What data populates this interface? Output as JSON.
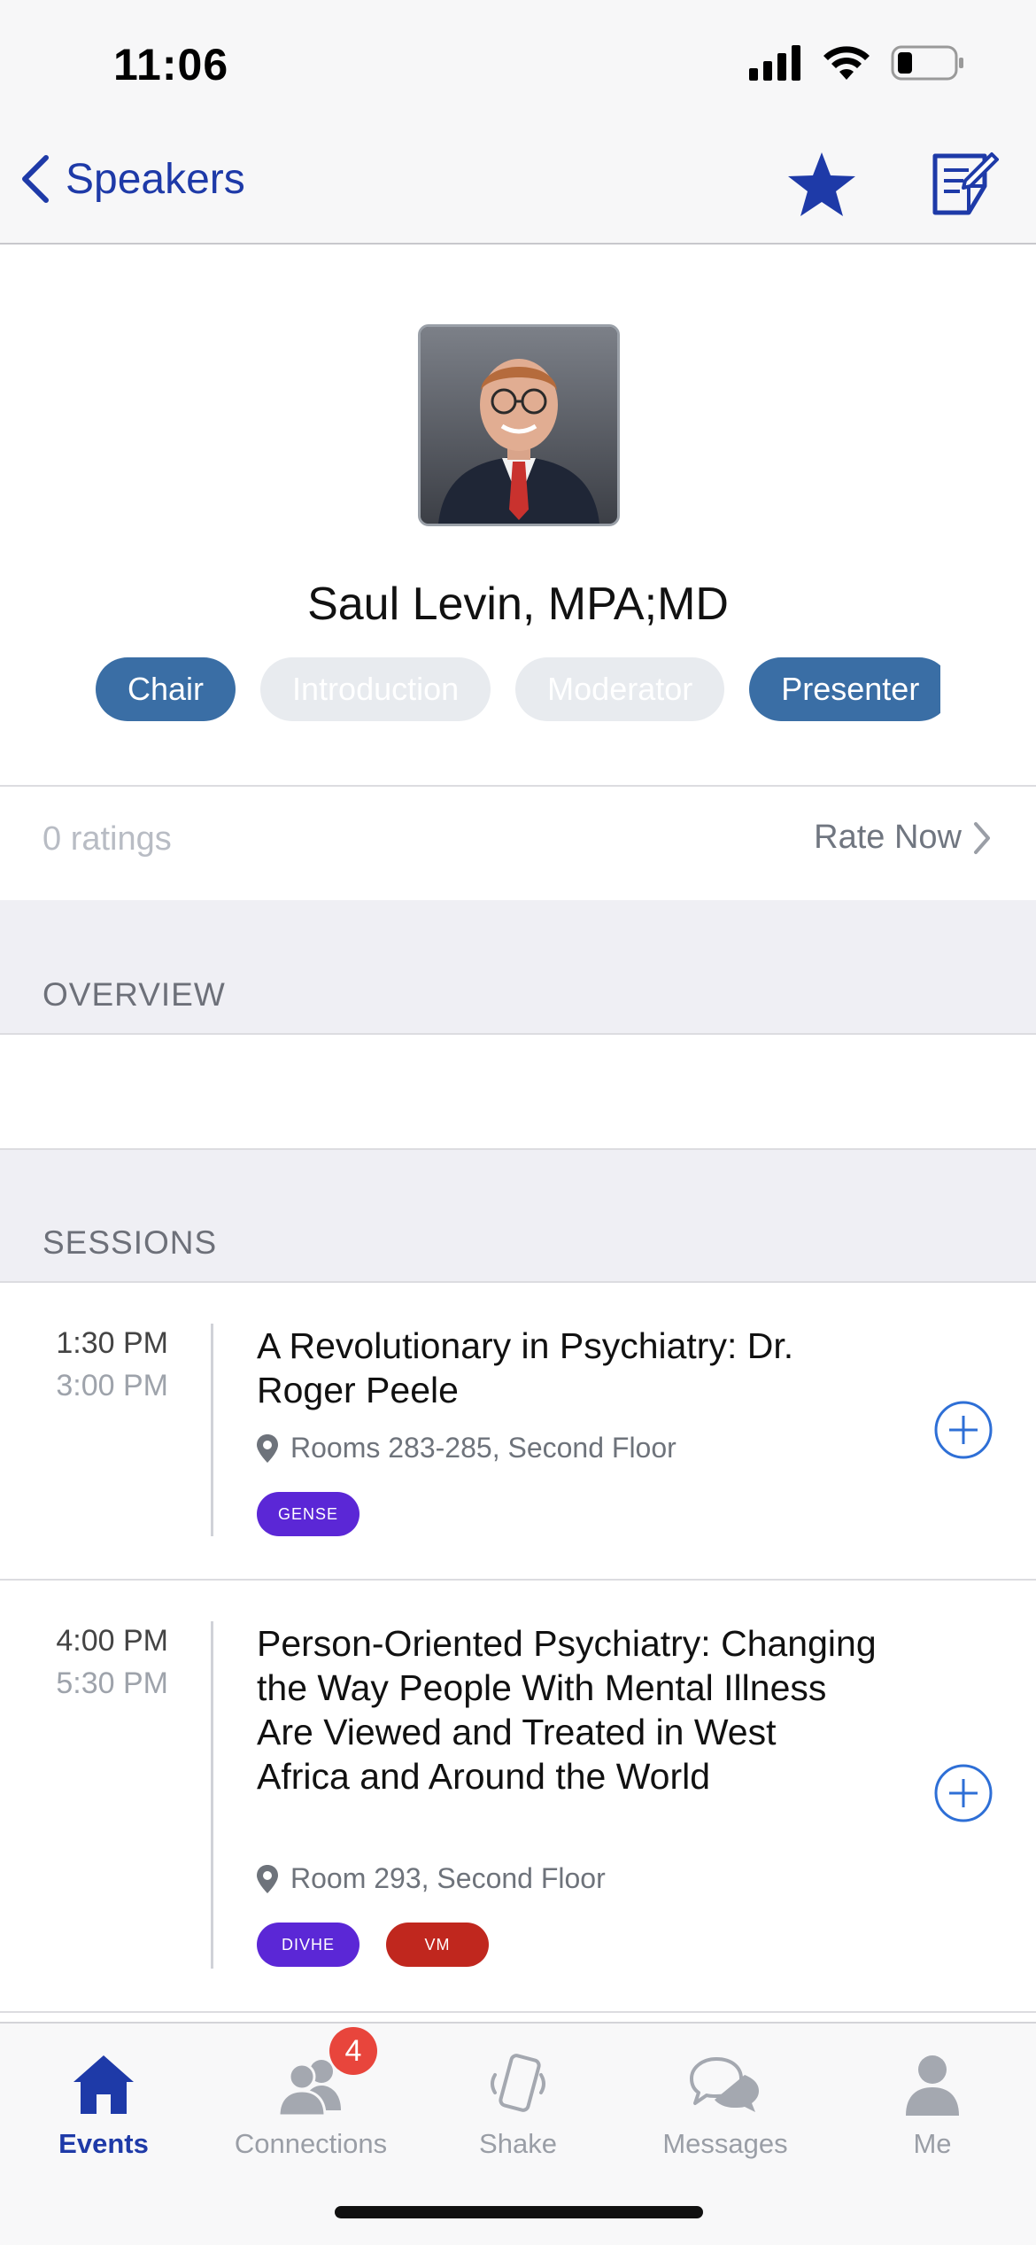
{
  "status_bar": {
    "time": "11:06"
  },
  "nav": {
    "back_label": "Speakers",
    "accent": "#1e3aa8"
  },
  "speaker": {
    "name": "Saul Levin, MPA;MD",
    "roles": [
      {
        "label": "Chair",
        "active": true
      },
      {
        "label": "Introduction",
        "active": false
      },
      {
        "label": "Moderator",
        "active": false
      },
      {
        "label": "Presenter",
        "active": true
      }
    ]
  },
  "ratings": {
    "count_text": "0 ratings",
    "rate_now_label": "Rate Now"
  },
  "overview": {
    "header": "OVERVIEW"
  },
  "sessions": {
    "header": "SESSIONS",
    "items": [
      {
        "start": "1:30 PM",
        "end": "3:00 PM",
        "title": "A Revolutionary in Psychiatry: Dr. Roger Peele",
        "location": "Rooms 283-285, Second Floor",
        "tags": [
          {
            "label": "GENSE",
            "color": "#5b27d6"
          }
        ]
      },
      {
        "start": "4:00 PM",
        "end": "5:30 PM",
        "title": "Person-Oriented Psychiatry: Changing the Way People With Mental Illness Are Viewed and Treated in West Africa and Around the World",
        "location": "Room 293, Second Floor",
        "tags": [
          {
            "label": "DIVHE",
            "color": "#5b27d6"
          },
          {
            "label": "VM",
            "color": "#c0271e"
          }
        ]
      }
    ]
  },
  "tab_bar": {
    "items": [
      {
        "label": "Events",
        "icon": "home-icon",
        "active": true
      },
      {
        "label": "Connections",
        "icon": "people-icon",
        "active": false,
        "badge": "4"
      },
      {
        "label": "Shake",
        "icon": "phone-shake-icon",
        "active": false
      },
      {
        "label": "Messages",
        "icon": "chat-bubbles-icon",
        "active": false
      },
      {
        "label": "Me",
        "icon": "person-icon",
        "active": false
      }
    ]
  }
}
